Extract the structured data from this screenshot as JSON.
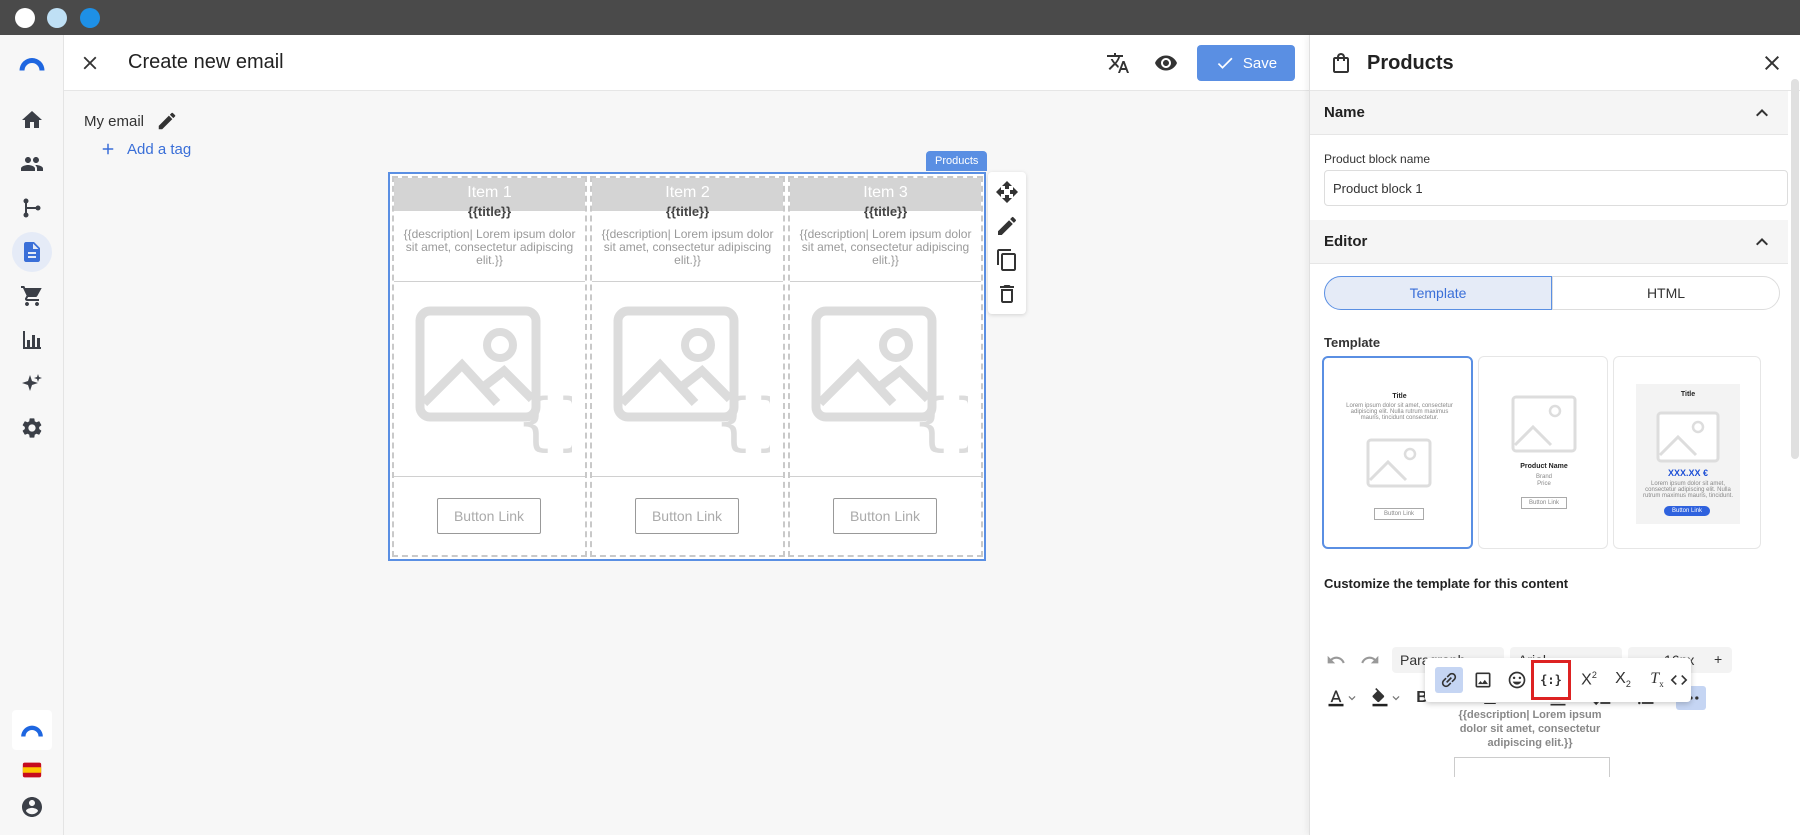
{
  "header": {
    "title": "Create new email",
    "save_label": "Save"
  },
  "canvas": {
    "email_name": "My email",
    "add_tag_label": "Add a tag",
    "block_tag": "Products",
    "columns": [
      {
        "heading": "Item 1",
        "title": "{{title}}",
        "description": "{{description| Lorem ipsum dolor sit amet, consectetur adipiscing elit.}}",
        "button": "Button Link"
      },
      {
        "heading": "Item 2",
        "title": "{{title}}",
        "description": "{{description| Lorem ipsum dolor sit amet, consectetur adipiscing elit.}}",
        "button": "Button Link"
      },
      {
        "heading": "Item 3",
        "title": "{{title}}",
        "description": "{{description| Lorem ipsum dolor sit amet, consectetur adipiscing elit.}}",
        "button": "Button Link"
      }
    ]
  },
  "panel": {
    "title": "Products",
    "name_section": "Name",
    "block_name_label": "Product block name",
    "block_name_value": "Product block 1",
    "editor_section": "Editor",
    "tabs": [
      "Template",
      "HTML"
    ],
    "template_label": "Template",
    "templates": [
      {
        "title": "Title",
        "body": "Lorem ipsum dolor sit amet, consectetur adipiscing elit. Nulla rutrum maximus mauris, tincidunt consectetur.",
        "button": "Button Link"
      },
      {
        "name": "Product Name",
        "brand": "Brand",
        "price": "Price",
        "button": "Button Link"
      },
      {
        "title": "Title",
        "price": "XXX.XX €",
        "body": "Lorem ipsum dolor sit amet, consectetur adipiscing elit. Nulla rutrum maximus mauris, tincidunt.",
        "button": "Button Link"
      }
    ],
    "customize_label": "Customize the template for this content",
    "toolbar": {
      "block_format": "Paragraph",
      "font_family": "Arial",
      "font_size": "16px",
      "minus": "−",
      "plus": "+"
    },
    "preview_description": "{{description| Lorem ipsum dolor sit amet, consectetur adipiscing elit.}}"
  },
  "colors": {
    "accent": "#5a8fe3",
    "highlight_border": "#dd2222",
    "titlebar": "#4a4a4a"
  }
}
